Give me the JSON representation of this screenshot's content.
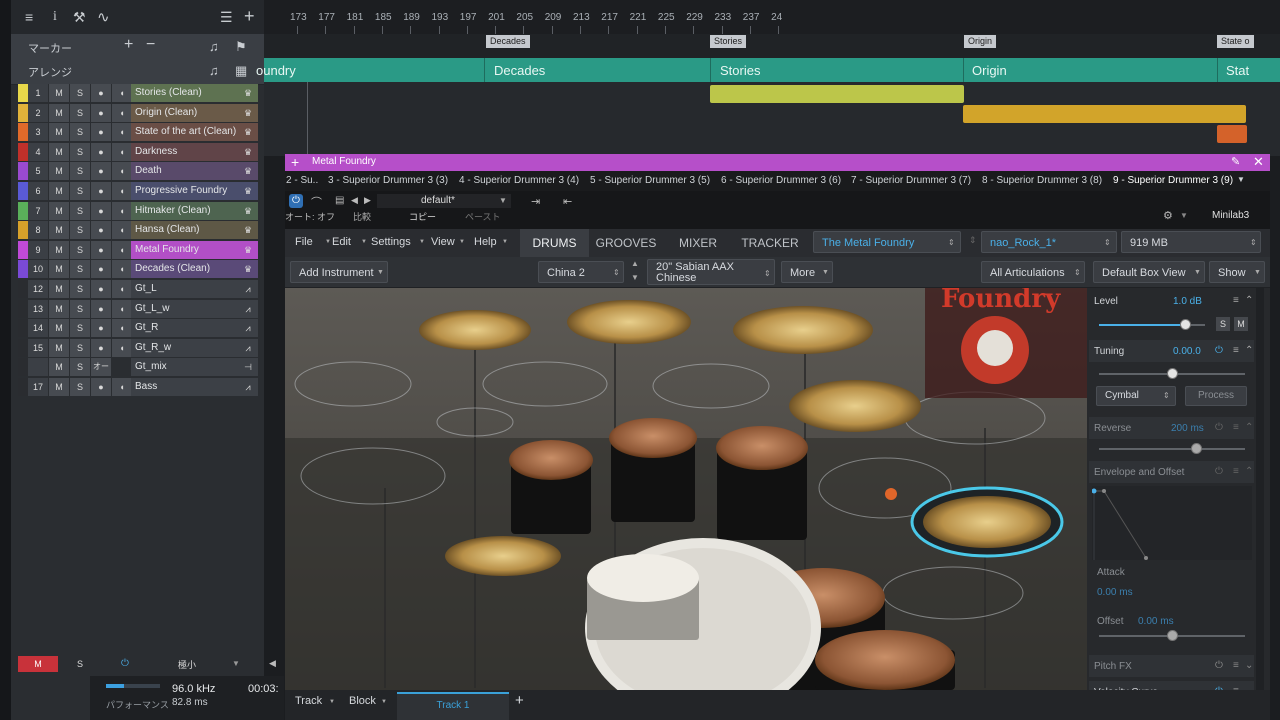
{
  "left": {
    "toolbar_icons": [
      "menu-icon",
      "info-icon",
      "wrench-icon",
      "curve-icon",
      "list-icon",
      "plus-icon"
    ],
    "marker_row": {
      "label": "マーカー",
      "plus": "+",
      "minus": "−",
      "note": "♫",
      "flag": "⚑"
    },
    "arrange_row": {
      "label": "アレンジ",
      "note": "♫",
      "grid": "▦"
    },
    "tracks": [
      {
        "num": "1",
        "name": "Stories (Clean)",
        "color": "#e8d84a",
        "bg": "#5e7251",
        "type": "♛"
      },
      {
        "num": "2",
        "name": "Origin (Clean)",
        "color": "#e0b23a",
        "bg": "#6a5a48",
        "type": "♛"
      },
      {
        "num": "3",
        "name": "State of the art (Clean)",
        "color": "#e06a2a",
        "bg": "#6a4e46",
        "type": "♛"
      },
      {
        "num": "4",
        "name": "Darkness",
        "color": "#c0302a",
        "bg": "#604448",
        "type": "♛"
      },
      {
        "num": "5",
        "name": "Death",
        "color": "#9a4ad0",
        "bg": "#594a6a",
        "type": "♛"
      },
      {
        "num": "6",
        "name": "Progressive Foundry",
        "color": "#5a5ad6",
        "bg": "#4a4e6c",
        "type": "♛"
      },
      {
        "num": "7",
        "name": "Hitmaker (Clean)",
        "color": "#5ab05a",
        "bg": "#4e6450",
        "type": "♛"
      },
      {
        "num": "8",
        "name": "Hansa (Clean)",
        "color": "#d6a02a",
        "bg": "#5e5846",
        "type": "♛"
      },
      {
        "num": "9",
        "name": "Metal Foundry",
        "color": "#c04ad8",
        "bg": "#b24fc6",
        "type": "♛"
      },
      {
        "num": "10",
        "name": "Decades (Clean)",
        "color": "#7a4ad6",
        "bg": "#5a4a78",
        "type": "♛"
      },
      {
        "num": "12",
        "name": "Gt_L",
        "color": "#2a2c30",
        "bg": "#3c4046",
        "type": "⩘"
      },
      {
        "num": "13",
        "name": "Gt_L_w",
        "color": "#2a2c30",
        "bg": "#3c4046",
        "type": "⩘"
      },
      {
        "num": "14",
        "name": "Gt_R",
        "color": "#2a2c30",
        "bg": "#3c4046",
        "type": "⩘"
      },
      {
        "num": "15",
        "name": "Gt_R_w",
        "color": "#2a2c30",
        "bg": "#3c4046",
        "type": "⩘"
      },
      {
        "num": "",
        "name": "Gt_mix",
        "color": "#2a2c30",
        "bg": "#3c4046",
        "type": "⊣",
        "auto": "オート: オフ"
      },
      {
        "num": "17",
        "name": "Bass",
        "color": "#2a2c30",
        "bg": "#3c4046",
        "type": "⩘"
      }
    ],
    "btn_m": "M",
    "btn_s": "S",
    "btn_rec": "●",
    "btn_mon": "◖",
    "status": {
      "m": "M",
      "s": "S",
      "power": "⏻",
      "size": "極小",
      "arrow": "▼",
      "left": "◀"
    }
  },
  "perf": {
    "rate": "96.0 kHz",
    "time": "00:03:",
    "label": "パフォーマンス",
    "latency": "82.8 ms"
  },
  "ruler": {
    "ticks": [
      "173",
      "177",
      "181",
      "185",
      "189",
      "193",
      "197",
      "201",
      "205",
      "209",
      "213",
      "217",
      "221",
      "225",
      "229",
      "233",
      "237",
      "24"
    ]
  },
  "markers": [
    "Decades",
    "Stories",
    "Origin",
    "State o"
  ],
  "arrangement": [
    "oundry",
    "Decades",
    "Stories",
    "Origin",
    "Stat"
  ],
  "plugin": {
    "title": "Metal Foundry",
    "tabs": [
      "2 - Su..",
      "3 - Superior Drummer 3 (3)",
      "4 - Superior Drummer 3 (4)",
      "5 - Superior Drummer 3 (5)",
      "6 - Superior Drummer 3 (6)",
      "7 - Superior Drummer 3 (7)",
      "8 - Superior Drummer 3 (8)",
      "9 - Superior Drummer 3 (9)"
    ],
    "auto": "オート: オフ",
    "compare": "比較",
    "copy": "コピー",
    "paste": "ペースト",
    "preset": "default*",
    "device": "Minilab3"
  },
  "sd": {
    "menu": [
      "File",
      "Edit",
      "Settings",
      "View",
      "Help"
    ],
    "tabs": [
      "DRUMS",
      "GROOVES",
      "MIXER",
      "TRACKER"
    ],
    "library": "The Metal Foundry",
    "preset": "nao_Rock_1*",
    "memory": "919 MB",
    "add_instrument": "Add Instrument",
    "instrument": "China 2",
    "cymbal": "20\" Sabian AAX Chinese",
    "more": "More",
    "articulations": "All Articulations",
    "box_view": "Default Box View",
    "show": "Show",
    "logo": "Foundry"
  },
  "right_panel": {
    "level": {
      "label": "Level",
      "value": "1.0 dB",
      "s": "S",
      "m": "M"
    },
    "tuning": {
      "label": "Tuning",
      "value": "0.00.0",
      "type": "Cymbal",
      "process": "Process"
    },
    "reverse": {
      "label": "Reverse",
      "value": "200 ms"
    },
    "envelope": {
      "label": "Envelope and Offset"
    },
    "attack": {
      "label": "Attack",
      "value": "0.00 ms"
    },
    "offset": {
      "label": "Offset",
      "value": "0.00 ms"
    },
    "pitch": {
      "label": "Pitch FX"
    },
    "velocity": {
      "label": "Velocity Curve"
    }
  },
  "bottom": {
    "track": "Track",
    "block": "Block",
    "track1": "Track 1",
    "plus": "+"
  }
}
